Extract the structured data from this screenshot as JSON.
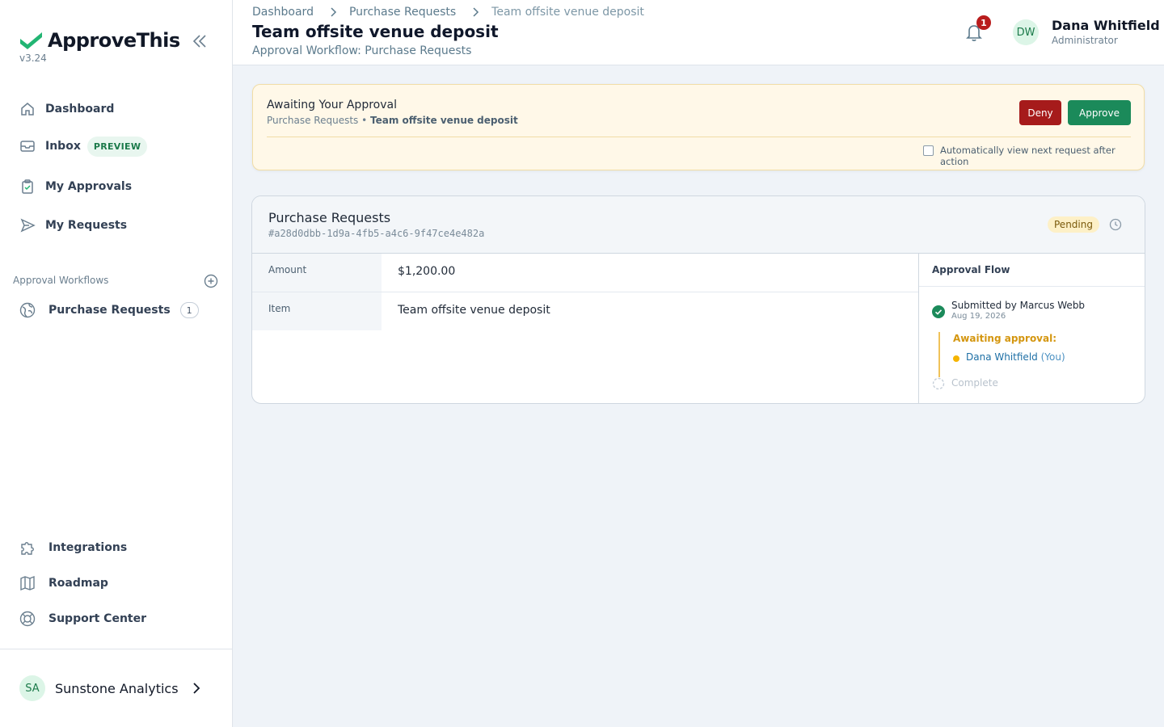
{
  "app": {
    "name": "ApproveThis",
    "version": "v3.24"
  },
  "sidebar": {
    "nav": [
      {
        "label": "Dashboard",
        "icon": "home-icon"
      },
      {
        "label": "Inbox",
        "icon": "inbox-icon",
        "badge": "PREVIEW"
      },
      {
        "label": "My Approvals",
        "icon": "clipboard-check-icon"
      },
      {
        "label": "My Requests",
        "icon": "send-icon"
      }
    ],
    "workflows_label": "Approval Workflows",
    "workflows": [
      {
        "label": "Purchase Requests",
        "icon": "globe-icon",
        "count": "1"
      }
    ],
    "footer_nav": [
      {
        "label": "Integrations",
        "icon": "puzzle-icon"
      },
      {
        "label": "Roadmap",
        "icon": "map-icon"
      },
      {
        "label": "Support Center",
        "icon": "lifebuoy-icon"
      }
    ],
    "org": {
      "initials": "SA",
      "name": "Sunstone Analytics"
    }
  },
  "header": {
    "breadcrumb": [
      "Dashboard",
      "Purchase Requests",
      "Team offsite venue deposit"
    ],
    "title": "Team offsite venue deposit",
    "subtitle": "Approval Workflow: Purchase Requests",
    "notifications_count": "1",
    "user": {
      "initials": "DW",
      "name": "Dana Whitfield",
      "role": "Administrator"
    }
  },
  "banner": {
    "title": "Awaiting Your Approval",
    "context": "Purchase Requests",
    "separator": " • ",
    "request_name": "Team offsite venue deposit",
    "deny_label": "Deny",
    "approve_label": "Approve",
    "auto_next_label": "Automatically view next request after action",
    "auto_next_checked": false
  },
  "request": {
    "workflow": "Purchase Requests",
    "id": "#a28d0dbb-1d9a-4fb5-a4c6-9f47ce4e482a",
    "status": "Pending",
    "fields": [
      {
        "key": "Amount",
        "value": "$1,200.00"
      },
      {
        "key": "Item",
        "value": "Team offsite venue deposit"
      }
    ],
    "flow": {
      "heading": "Approval Flow",
      "submitted": "Submitted by Marcus Webb",
      "submitted_date": "Aug 19, 2026",
      "awaiting_label": "Awaiting approval:",
      "approver": "Dana Whitfield",
      "approver_suffix": "(You)",
      "complete_label": "Complete"
    }
  },
  "colors": {
    "brand": "#1b8a5a",
    "deny": "#a61b1b",
    "pending_bg": "#fdf0c7",
    "awaiting": "#d4960f",
    "link": "#1d6fa5"
  }
}
